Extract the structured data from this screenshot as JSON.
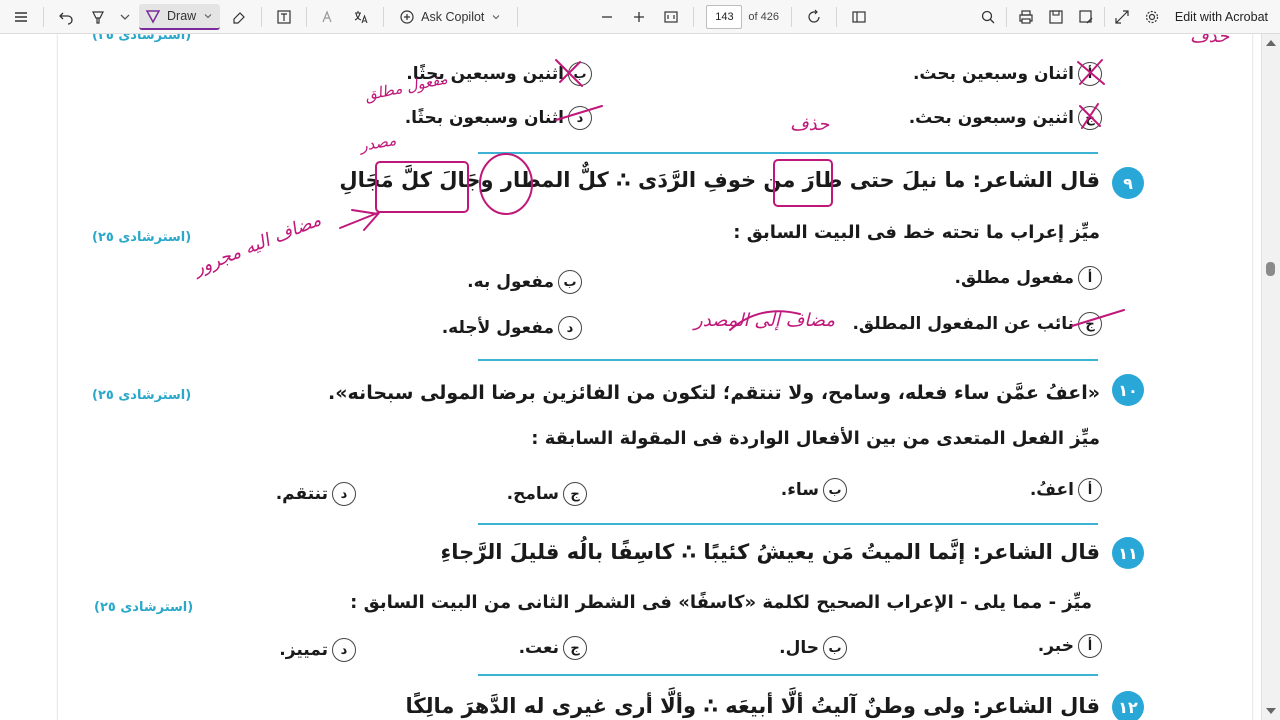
{
  "toolbar": {
    "draw_label": "Draw",
    "copilot_label": "Ask Copilot",
    "page_current": "143",
    "page_total": "of 426",
    "edit_label": "Edit with Acrobat"
  },
  "doc": {
    "top_partial": {
      "source_tag": "(استرشادى ٢٥)",
      "opt_a": "اثنان وسبعين بحث.",
      "opt_b": "اثنين وسبعين بحثًا.",
      "opt_c": "اثنين وسبعون بحث.",
      "opt_d": "اثنان وسبعون بحثًا."
    },
    "q9": {
      "number": "٩",
      "text": "قال الشاعر: ما نيلَ حتى طارَ من خوفِ الرَّدَى ∴ كلٌّ المطار وجَالَ كلَّ مَجَالِ",
      "source_tag": "(استرشادى ٢٥)",
      "instruction": "ميِّز إعراب ما تحته خط فى البيت السابق :",
      "options": [
        {
          "letter": "أ",
          "text": "مفعول مطلق."
        },
        {
          "letter": "ب",
          "text": "مفعول به."
        },
        {
          "letter": "ج",
          "text": "نائب عن المفعول المطلق."
        },
        {
          "letter": "د",
          "text": "مفعول لأجله."
        }
      ]
    },
    "q10": {
      "number": "١٠",
      "text": "«اعفُ عمَّن ساء فعله، وسامح، ولا تنتقم؛ لتكون من الفائزين برضا المولى سبحانه».",
      "source_tag": "(استرشادى ٢٥)",
      "instruction": "ميِّز الفعل المتعدى من بين الأفعال الواردة فى المقولة السابقة :",
      "options": [
        {
          "letter": "أ",
          "text": "اعفُ."
        },
        {
          "letter": "ب",
          "text": "ساء."
        },
        {
          "letter": "ج",
          "text": "سامح."
        },
        {
          "letter": "د",
          "text": "تنتقم."
        }
      ]
    },
    "q11": {
      "number": "١١",
      "text": "قال الشاعر: إنَّما الميتُ مَن يعيشُ كئيبًا ∴ كاسِفًا بالُه قليلَ الرَّجاءِ",
      "source_tag": "(استرشادى ٢٥)",
      "instruction": "ميِّز - مما يلى - الإعراب الصحيح لكلمة «كاسفًا» فى الشطر الثانى من البيت السابق :",
      "options": [
        {
          "letter": "أ",
          "text": "خبر."
        },
        {
          "letter": "ب",
          "text": "حال."
        },
        {
          "letter": "ج",
          "text": "نعت."
        },
        {
          "letter": "د",
          "text": "تمييز."
        }
      ]
    },
    "q12": {
      "number": "١٢",
      "text": "قال الشاعر: ولى وطنٌ آليتُ ألَّا أبيعَه ∴ وألَّا أرى غيرى له الدَّهرَ مالِكًا"
    },
    "ink": {
      "a1": "حذف",
      "a2": "مفعول مطلق",
      "a3": "مصدر",
      "a4": "مضاف اليه مجرور",
      "a5": "مضاف إلى المصدر"
    }
  },
  "colors": {
    "accent": "#29a8d8",
    "ink": "#c0187a",
    "draw_active": "#7a2d9a"
  }
}
